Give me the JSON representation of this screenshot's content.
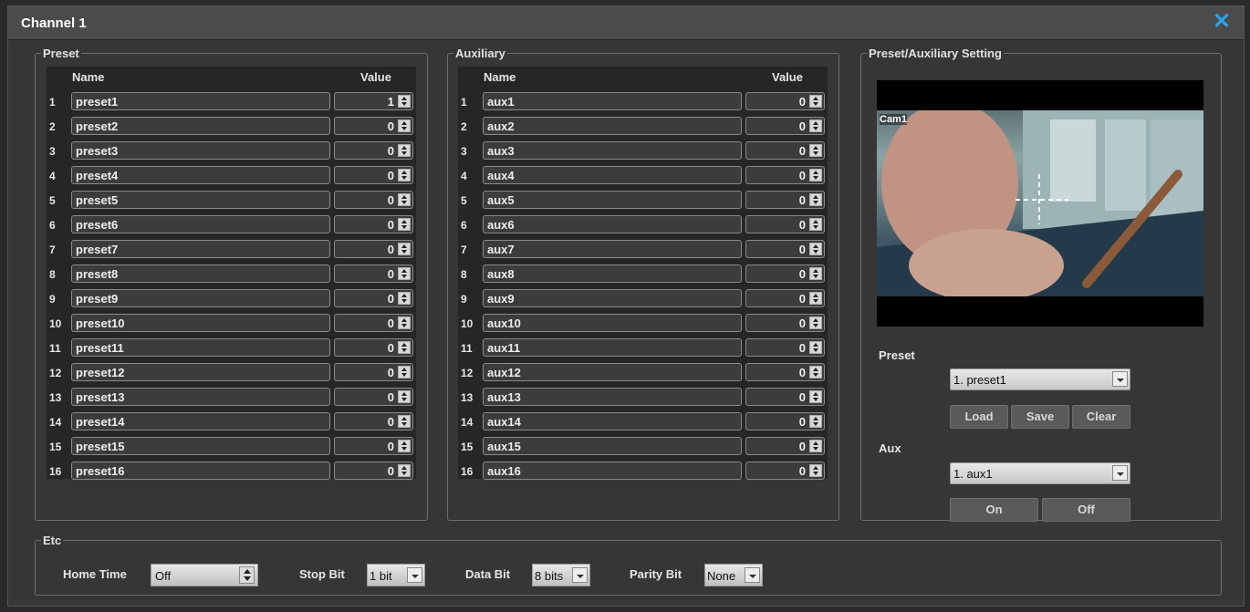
{
  "window": {
    "title": "Channel 1"
  },
  "preset": {
    "legend": "Preset",
    "name_header": "Name",
    "value_header": "Value",
    "rows": [
      {
        "num": "1",
        "name": "preset1",
        "value": "1"
      },
      {
        "num": "2",
        "name": "preset2",
        "value": "0"
      },
      {
        "num": "3",
        "name": "preset3",
        "value": "0"
      },
      {
        "num": "4",
        "name": "preset4",
        "value": "0"
      },
      {
        "num": "5",
        "name": "preset5",
        "value": "0"
      },
      {
        "num": "6",
        "name": "preset6",
        "value": "0"
      },
      {
        "num": "7",
        "name": "preset7",
        "value": "0"
      },
      {
        "num": "8",
        "name": "preset8",
        "value": "0"
      },
      {
        "num": "9",
        "name": "preset9",
        "value": "0"
      },
      {
        "num": "10",
        "name": "preset10",
        "value": "0"
      },
      {
        "num": "11",
        "name": "preset11",
        "value": "0"
      },
      {
        "num": "12",
        "name": "preset12",
        "value": "0"
      },
      {
        "num": "13",
        "name": "preset13",
        "value": "0"
      },
      {
        "num": "14",
        "name": "preset14",
        "value": "0"
      },
      {
        "num": "15",
        "name": "preset15",
        "value": "0"
      },
      {
        "num": "16",
        "name": "preset16",
        "value": "0"
      }
    ]
  },
  "auxiliary": {
    "legend": "Auxiliary",
    "name_header": "Name",
    "value_header": "Value",
    "rows": [
      {
        "num": "1",
        "name": "aux1",
        "value": "0"
      },
      {
        "num": "2",
        "name": "aux2",
        "value": "0"
      },
      {
        "num": "3",
        "name": "aux3",
        "value": "0"
      },
      {
        "num": "4",
        "name": "aux4",
        "value": "0"
      },
      {
        "num": "5",
        "name": "aux5",
        "value": "0"
      },
      {
        "num": "6",
        "name": "aux6",
        "value": "0"
      },
      {
        "num": "7",
        "name": "aux7",
        "value": "0"
      },
      {
        "num": "8",
        "name": "aux8",
        "value": "0"
      },
      {
        "num": "9",
        "name": "aux9",
        "value": "0"
      },
      {
        "num": "10",
        "name": "aux10",
        "value": "0"
      },
      {
        "num": "11",
        "name": "aux11",
        "value": "0"
      },
      {
        "num": "12",
        "name": "aux12",
        "value": "0"
      },
      {
        "num": "13",
        "name": "aux13",
        "value": "0"
      },
      {
        "num": "14",
        "name": "aux14",
        "value": "0"
      },
      {
        "num": "15",
        "name": "aux15",
        "value": "0"
      },
      {
        "num": "16",
        "name": "aux16",
        "value": "0"
      }
    ]
  },
  "setting": {
    "legend": "Preset/Auxiliary Setting",
    "camera_label": "Cam1",
    "preset_label": "Preset",
    "preset_selected": "1. preset1",
    "load": "Load",
    "save": "Save",
    "clear": "Clear",
    "aux_label": "Aux",
    "aux_selected": "1. aux1",
    "on": "On",
    "off": "Off"
  },
  "etc": {
    "legend": "Etc",
    "home_time_label": "Home Time",
    "home_time_value": "Off",
    "stop_bit_label": "Stop Bit",
    "stop_bit_value": "1 bit",
    "data_bit_label": "Data Bit",
    "data_bit_value": "8 bits",
    "parity_bit_label": "Parity Bit",
    "parity_bit_value": "None"
  },
  "colors": {
    "accent": "#29a3e8",
    "panel": "#363636"
  }
}
